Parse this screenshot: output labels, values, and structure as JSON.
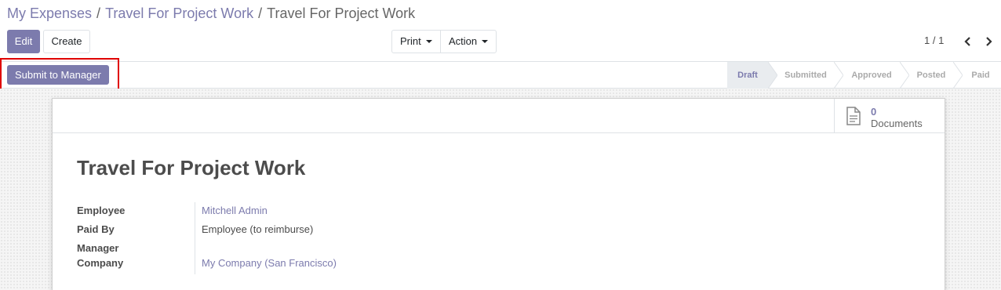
{
  "breadcrumb": {
    "items": [
      "My Expenses",
      "Travel For Project Work"
    ],
    "separator": "/",
    "current": "Travel For Project Work"
  },
  "toolbar": {
    "edit_label": "Edit",
    "create_label": "Create",
    "print_label": "Print",
    "action_label": "Action"
  },
  "pager": {
    "value": "1 / 1",
    "prev_icon": "chevron-left-icon",
    "next_icon": "chevron-right-icon"
  },
  "statusbar": {
    "submit_label": "Submit to Manager",
    "stages": [
      "Draft",
      "Submitted",
      "Approved",
      "Posted",
      "Paid"
    ],
    "current_stage": "Draft"
  },
  "smart_button": {
    "icon": "document-icon",
    "count": "0",
    "label": "Documents"
  },
  "record": {
    "title": "Travel For Project Work",
    "fields": [
      {
        "label": "Employee",
        "value": "Mitchell Admin"
      },
      {
        "label": "Paid By",
        "value": "Employee (to reimburse)"
      },
      {
        "label": "Manager",
        "value": ""
      },
      {
        "label": "Company",
        "value": "My Company (San Francisco)"
      }
    ]
  },
  "colors": {
    "accent": "#7c7bad",
    "highlight": "#e00000"
  }
}
